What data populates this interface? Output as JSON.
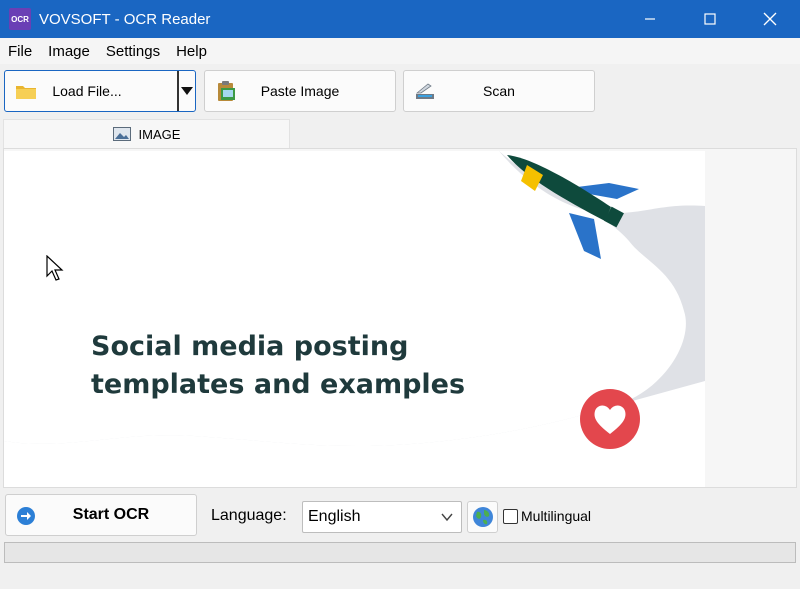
{
  "window": {
    "title": "VOVSOFT - OCR Reader",
    "app_icon_text": "OCR",
    "controls": [
      "minimize",
      "maximize",
      "close"
    ]
  },
  "menu": {
    "items": [
      "File",
      "Image",
      "Settings",
      "Help"
    ]
  },
  "toolbar": {
    "load_label": "Load File...",
    "paste_label": "Paste Image",
    "scan_label": "Scan"
  },
  "tab": {
    "label": "IMAGE"
  },
  "image": {
    "headline_line1": "Social media posting",
    "headline_line2": "templates and examples",
    "colors": {
      "backdrop": "#dfe1e6",
      "text": "#1f3a3c",
      "rocket_body": "#0e4a3c",
      "rocket_band": "#f5c000",
      "rocket_fins": "#2a73c9",
      "heart_badge": "#e3474d"
    }
  },
  "bottom": {
    "start_label": "Start OCR",
    "language_label": "Language:",
    "language_value": "English",
    "multilingual_label": "Multilingual",
    "multilingual_checked": false
  },
  "progress": {
    "value": 0
  }
}
